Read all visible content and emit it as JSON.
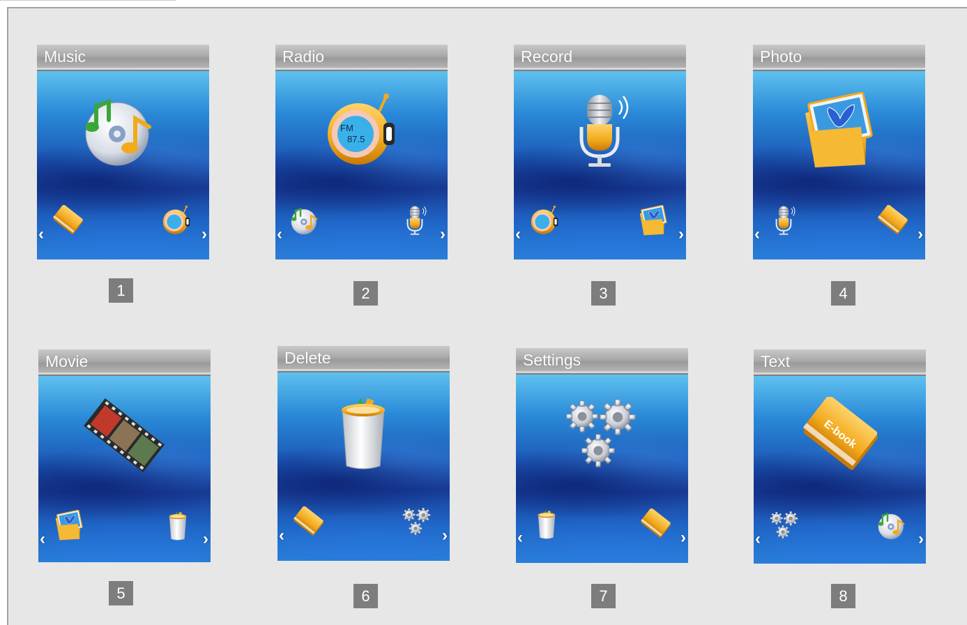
{
  "screens": [
    {
      "title": "Music",
      "number": "1",
      "main_icon": "music-cd-icon",
      "left_icon": "ebook-icon",
      "right_icon": "radio-icon"
    },
    {
      "title": "Radio",
      "number": "2",
      "main_icon": "radio-icon",
      "main_label_line1": "FM",
      "main_label_line2": "87.5",
      "left_icon": "music-cd-icon",
      "right_icon": "microphone-icon"
    },
    {
      "title": "Record",
      "number": "3",
      "main_icon": "microphone-icon",
      "left_icon": "radio-icon",
      "right_icon": "photo-folder-icon"
    },
    {
      "title": "Photo",
      "number": "4",
      "main_icon": "photo-folder-icon",
      "left_icon": "microphone-icon",
      "right_icon": "ebook-icon"
    },
    {
      "title": "Movie",
      "number": "5",
      "main_icon": "film-strip-icon",
      "left_icon": "photo-folder-icon",
      "right_icon": "trash-can-icon"
    },
    {
      "title": "Delete",
      "number": "6",
      "main_icon": "trash-can-icon",
      "left_icon": "ebook-icon",
      "right_icon": "gears-icon"
    },
    {
      "title": "Settings",
      "number": "7",
      "main_icon": "gears-icon",
      "left_icon": "trash-can-icon",
      "right_icon": "ebook-icon"
    },
    {
      "title": "Text",
      "number": "8",
      "main_icon": "ebook-icon",
      "main_label": "E-book",
      "left_icon": "gears-icon",
      "right_icon": "music-cd-icon"
    }
  ],
  "nav": {
    "left_arrow": "‹",
    "right_arrow": "›"
  },
  "colors": {
    "frame_bg": "#e7e7e7",
    "titlebar": "#a9a9a9",
    "number_box": "#7d7d7d",
    "screen_blue": "#1b56b5",
    "accent_orange": "#f2a91c"
  }
}
